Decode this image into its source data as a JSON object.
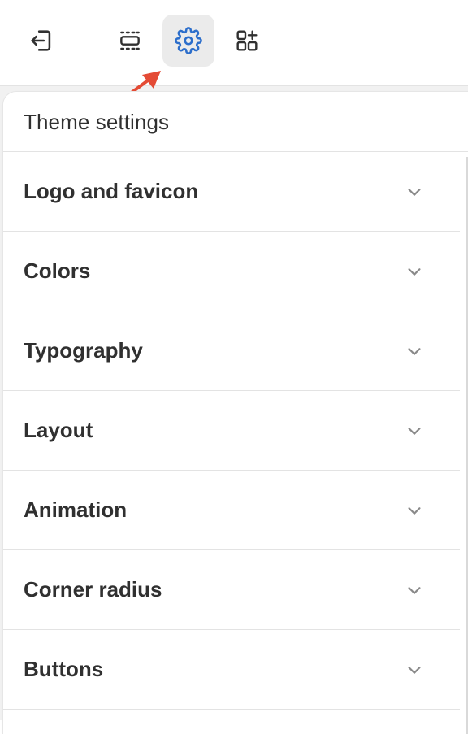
{
  "toolbar": {
    "exit_icon": "exit-icon",
    "sections_icon": "sections-icon",
    "settings_icon": "gear-icon",
    "apps_icon": "apps-add-icon",
    "active": "settings",
    "accent_color": "#2c6ecb",
    "annotation_arrow_color": "#e44b35"
  },
  "panel": {
    "title": "Theme settings",
    "items": [
      {
        "label": "Logo and favicon"
      },
      {
        "label": "Colors"
      },
      {
        "label": "Typography"
      },
      {
        "label": "Layout"
      },
      {
        "label": "Animation"
      },
      {
        "label": "Corner radius"
      },
      {
        "label": "Buttons"
      }
    ]
  }
}
